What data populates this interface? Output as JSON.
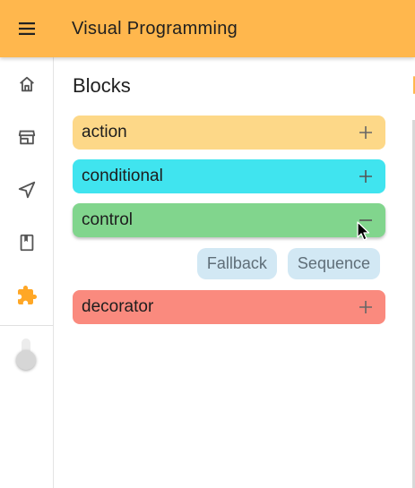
{
  "app": {
    "title": "Visual Programming",
    "accent_color": "#ffb74d",
    "menu_icon": "menu-icon"
  },
  "sidebar": {
    "items": [
      {
        "id": "home",
        "icon": "home-icon"
      },
      {
        "id": "store",
        "icon": "store-icon"
      },
      {
        "id": "navigate",
        "icon": "navigation-icon"
      },
      {
        "id": "book",
        "icon": "book-icon"
      },
      {
        "id": "blocks",
        "icon": "puzzle-icon",
        "active": true,
        "color": "#ffa726"
      }
    ],
    "theme_toggle": {
      "on": false
    }
  },
  "panel": {
    "title": "Blocks",
    "blocks": [
      {
        "label": "action",
        "color": "#fdd888",
        "expanded": false,
        "toggle_icon": "plus-icon"
      },
      {
        "label": "conditional",
        "color": "#40e4ef",
        "expanded": false,
        "toggle_icon": "plus-icon"
      },
      {
        "label": "control",
        "color": "#81d58d",
        "expanded": true,
        "toggle_icon": "minus-icon",
        "children": [
          "Fallback",
          "Sequence"
        ]
      },
      {
        "label": "decorator",
        "color": "#fa8a7e",
        "expanded": false,
        "toggle_icon": "plus-icon"
      }
    ],
    "chip_color": "#d2e8f4"
  }
}
